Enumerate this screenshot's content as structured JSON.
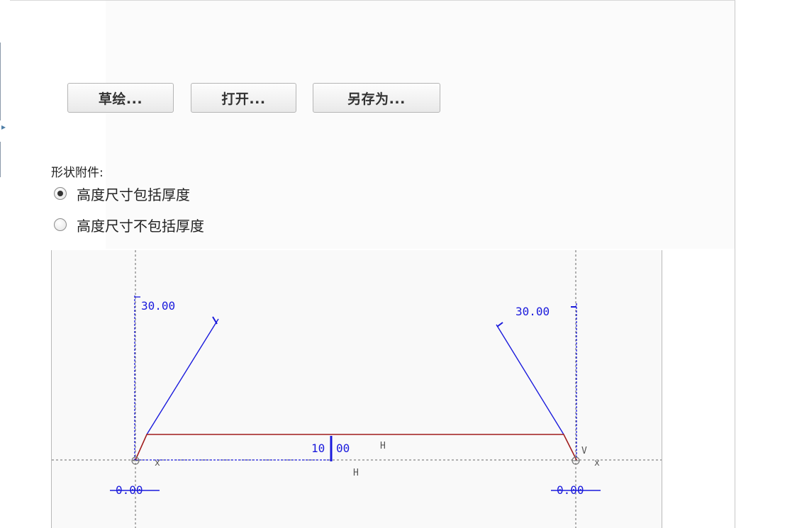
{
  "toolbar": {
    "sketch_label": "草绘...",
    "open_label": "打开...",
    "save_as_label": "另存为..."
  },
  "shape_attachment": {
    "label": "形状附件:",
    "options": [
      {
        "label": "高度尺寸包括厚度",
        "selected": true
      },
      {
        "label": "高度尺寸不包括厚度",
        "selected": false
      }
    ]
  },
  "diagram": {
    "dim_left_angle": "30.00",
    "dim_right_angle": "30.00",
    "dim_thickness": "10",
    "dim_thickness_decimal": "00",
    "label_h_upper": "H",
    "label_h_lower": "H",
    "label_v": "V",
    "dim_left_bottom": "0.00",
    "dim_right_bottom": "0.00",
    "axis_x_left": "x",
    "axis_x_right": "x",
    "colors": {
      "dimension": "#1a1adc",
      "profile": "#a01c1c",
      "centerline": "#666666"
    }
  }
}
